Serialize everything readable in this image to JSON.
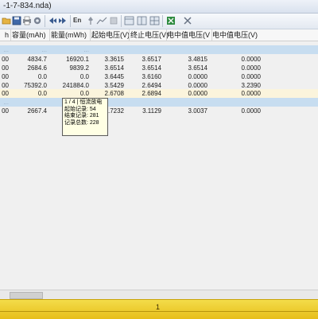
{
  "window": {
    "title": "-1-7-834.nda)"
  },
  "columns": [
    {
      "key": "h0",
      "label": "h"
    },
    {
      "key": "h1",
      "label": "容量(mAh)"
    },
    {
      "key": "h2",
      "label": "能量(mWh)"
    },
    {
      "key": "h3",
      "label": "起始电压(V)"
    },
    {
      "key": "h4",
      "label": "终止电压(V)"
    },
    {
      "key": "h5",
      "label": "电中值电压(V"
    },
    {
      "key": "h6",
      "label": "电中值电压(V)"
    }
  ],
  "rows": [
    {
      "type": "group",
      "cells": [
        "...",
        "...",
        "...",
        "",
        "",
        "",
        ""
      ]
    },
    {
      "type": "data",
      "cells": [
        "00",
        "4834.7",
        "16920.1",
        "3.3615",
        "3.6517",
        "3.4815",
        "0.0000"
      ]
    },
    {
      "type": "data",
      "cells": [
        "00",
        "2684.6",
        "9839.2",
        "3.6514",
        "3.6514",
        "3.6514",
        "0.0000"
      ]
    },
    {
      "type": "data",
      "cells": [
        "00",
        "0.0",
        "0.0",
        "3.6445",
        "3.6160",
        "0.0000",
        "0.0000"
      ]
    },
    {
      "type": "data",
      "cells": [
        "00",
        "75392.0",
        "241884.0",
        "3.5429",
        "2.6494",
        "0.0000",
        "3.2390"
      ]
    },
    {
      "type": "selected",
      "cells": [
        "00",
        "0.0",
        "0.0",
        "2.6708",
        "2.6894",
        "0.0000",
        "0.0000"
      ]
    },
    {
      "type": "group",
      "cells": [
        "...",
        "",
        "",
        "",
        "",
        "",
        ""
      ]
    },
    {
      "type": "data",
      "cells": [
        "00",
        "2667.4",
        "",
        "2.7232",
        "3.1129",
        "3.0037",
        "0.0000"
      ]
    }
  ],
  "tooltip": {
    "title": "1 / 4 | 恒流放电",
    "line1": "起始记录: 54",
    "line2": "结束记录: 281",
    "line3": "记录总数: 228"
  },
  "status": {
    "page": "1"
  },
  "toolbar": {
    "en_label": "En"
  },
  "colors": {
    "group_row": "#c7ddf0",
    "selected_row": "#fbf4dc",
    "tooltip_bg": "#ffffe4",
    "status_bar": "#e7be1a"
  }
}
